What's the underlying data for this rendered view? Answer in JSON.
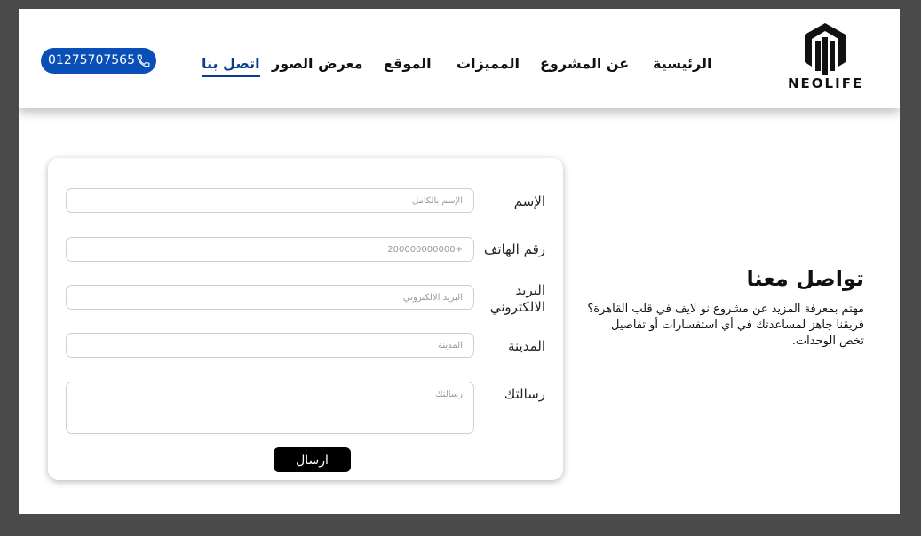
{
  "brand": {
    "logo_text": "NEOLIFE",
    "logo_icon": "neolife-logo-icon"
  },
  "nav": {
    "items": [
      {
        "label": "الرئيسية"
      },
      {
        "label": "عن المشروع"
      },
      {
        "label": "المميزات"
      },
      {
        "label": "الموقع"
      },
      {
        "label": "معرض الصور"
      },
      {
        "label": "اتصل بنا",
        "active": true
      }
    ]
  },
  "phone": {
    "number": "01275707565",
    "icon": "phone-icon"
  },
  "intro": {
    "title": "تواصل معنا",
    "description": "مهتم بمعرفة المزيد عن مشروع نو لايف في قلب القاهرة؟ فريقنا جاهز لمساعدتك في أي استفسارات أو تفاصيل تخص الوحدات."
  },
  "form": {
    "name": {
      "label": "الإسم",
      "placeholder": "الإسم بالكامل"
    },
    "phone": {
      "label": "رقم الهاتف",
      "placeholder": "+200000000000"
    },
    "email": {
      "label": "البريد الالكتروني",
      "placeholder": "البريد الالكتروني"
    },
    "city": {
      "label": "المدينة",
      "placeholder": "المدينة"
    },
    "message": {
      "label": "رسالتك",
      "placeholder": "رسالتك"
    },
    "submit_label": "ارسال"
  },
  "colors": {
    "accent": "#0a4fb8",
    "active_nav": "#0a3d8f",
    "page_background": "#4a4a4a"
  }
}
